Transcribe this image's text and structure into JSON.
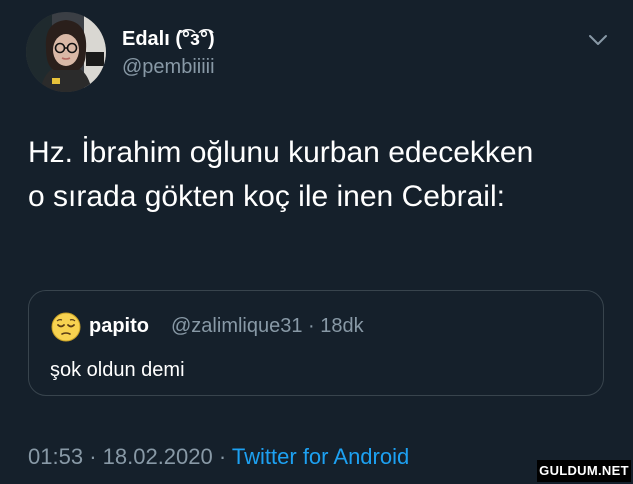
{
  "tweet": {
    "author": {
      "name": "Edalı (͡°з͡°)",
      "handle": "@pembiiiii"
    },
    "text_lines": [
      "Hz. İbrahim oğlunu kurban edecekken",
      "o sırada gökten koç ile inen Cebrail:"
    ],
    "quoted": {
      "name": "papito",
      "handle": "@zalimlique31",
      "separator": "·",
      "time": "18dk",
      "text": "şok oldun demi"
    },
    "footer": {
      "time": "01:53",
      "dot1": "·",
      "date": "18.02.2020",
      "dot2": "·",
      "source": "Twitter for Android"
    }
  },
  "watermark": "GULDUM.NET",
  "colors": {
    "background": "#15202b",
    "text": "#ffffff",
    "muted": "#8899a6",
    "link": "#1da1f2",
    "border": "#38444d"
  },
  "icons": {
    "avatar": "profile-photo",
    "quote_avatar": "sleepy-face-emoji",
    "menu": "chevron-down-icon"
  }
}
